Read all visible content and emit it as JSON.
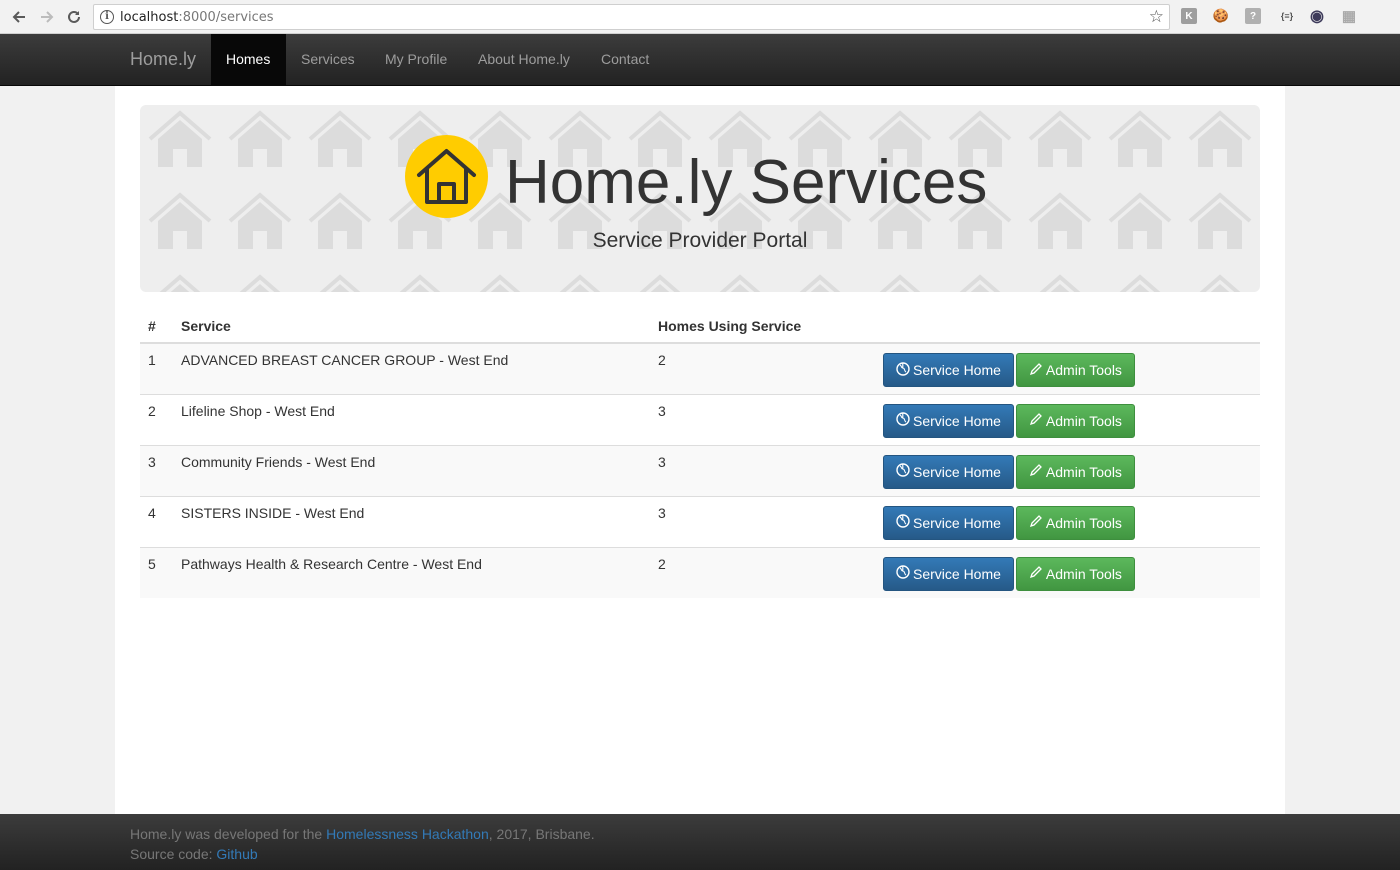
{
  "browser": {
    "url_host": "localhost",
    "url_path": ":8000/services",
    "extensions": [
      {
        "name": "k-extension-icon",
        "glyph": "K"
      },
      {
        "name": "cookie-extension-icon",
        "glyph": "🍪"
      },
      {
        "name": "help-extension-icon",
        "glyph": "?"
      },
      {
        "name": "json-extension-icon",
        "glyph": "{≡}"
      },
      {
        "name": "circle-extension-icon",
        "glyph": "◉"
      },
      {
        "name": "grid-extension-icon",
        "glyph": "▦"
      }
    ]
  },
  "navbar": {
    "brand": "Home.ly",
    "items": [
      {
        "label": "Homes",
        "active": true
      },
      {
        "label": "Services",
        "active": false
      },
      {
        "label": "My Profile",
        "active": false
      },
      {
        "label": "About Home.ly",
        "active": false
      },
      {
        "label": "Contact",
        "active": false
      }
    ]
  },
  "jumbotron": {
    "title": "Home.ly Services",
    "subtitle": "Service Provider Portal"
  },
  "table": {
    "headers": [
      "#",
      "Service",
      "Homes Using Service"
    ],
    "rows": [
      {
        "num": "1",
        "service": "ADVANCED BREAST CANCER GROUP - West End",
        "homes": "2"
      },
      {
        "num": "2",
        "service": "Lifeline Shop - West End",
        "homes": "3"
      },
      {
        "num": "3",
        "service": "Community Friends - West End",
        "homes": "3"
      },
      {
        "num": "4",
        "service": "SISTERS INSIDE - West End",
        "homes": "3"
      },
      {
        "num": "5",
        "service": "Pathways Health & Research Centre - West End",
        "homes": "2"
      }
    ],
    "service_home_label": "Service Home",
    "admin_tools_label": "Admin Tools"
  },
  "footer": {
    "line1_prefix": "Home.ly was developed for the ",
    "line1_link": "Homelessness Hackathon",
    "line1_suffix": ", 2017, Brisbane.",
    "line2_prefix": "Source code: ",
    "line2_link": "Github"
  },
  "colors": {
    "logo_yellow": "#ffcc00",
    "primary_blue": "#337ab7",
    "success_green": "#5cb85c"
  }
}
